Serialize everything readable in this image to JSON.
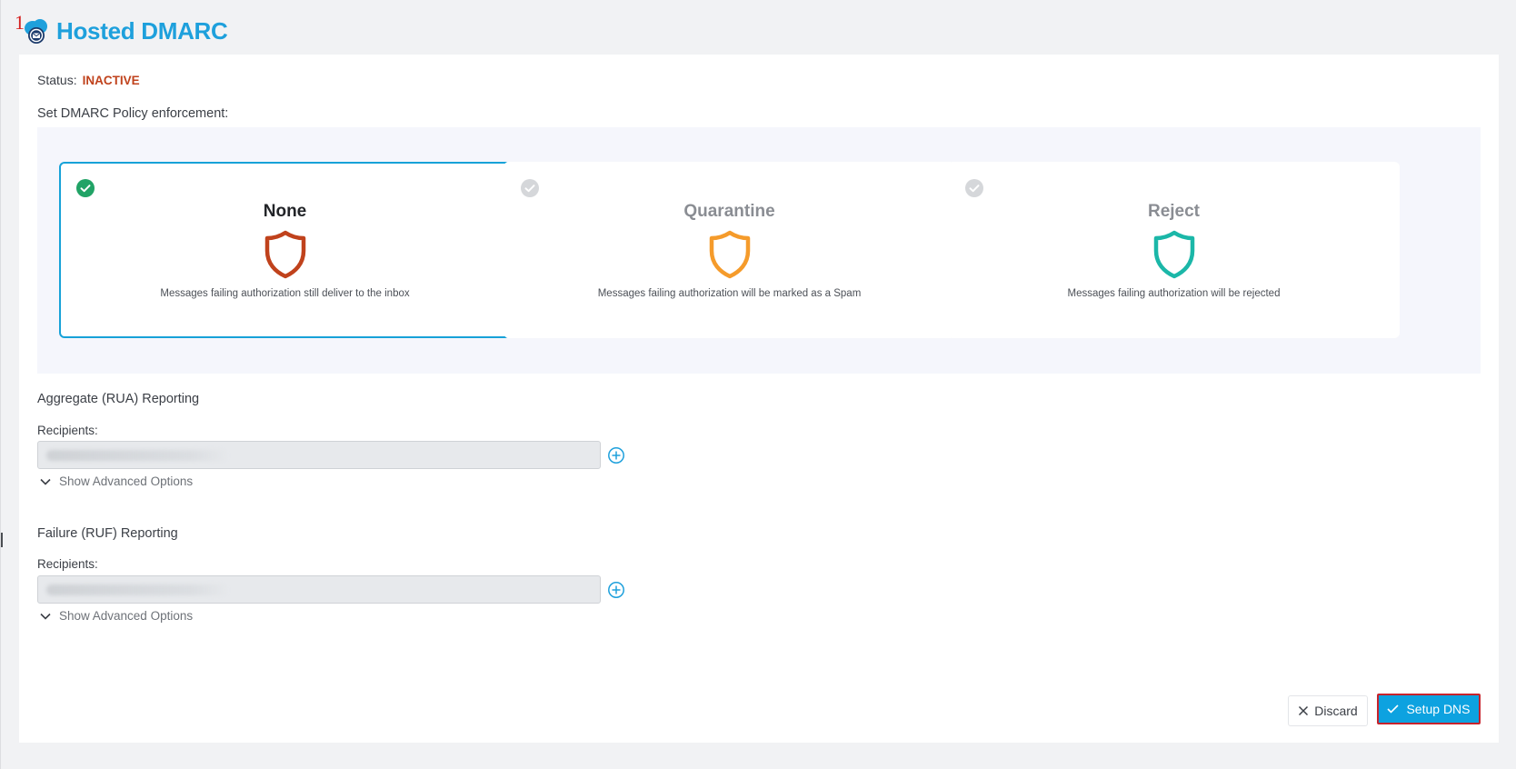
{
  "marker": "1",
  "app": {
    "title": "Hosted DMARC"
  },
  "status": {
    "label": "Status:",
    "value": "INACTIVE",
    "value_color": "#c0421c"
  },
  "policy": {
    "label": "Set DMARC Policy enforcement:",
    "selected": "None",
    "options": [
      {
        "name": "None",
        "description": "Messages failing authorization still deliver to the inbox",
        "shield_color": "#c0421c",
        "icon": "shield-icon",
        "selected": true
      },
      {
        "name": "Quarantine",
        "description": "Messages failing authorization will be marked as a Spam",
        "shield_color": "#f59b2b",
        "icon": "shield-icon",
        "selected": false
      },
      {
        "name": "Reject",
        "description": "Messages failing authorization will be rejected",
        "shield_color": "#1bb7a8",
        "icon": "shield-icon",
        "selected": false
      }
    ]
  },
  "rua": {
    "title": "Aggregate (RUA) Reporting",
    "recipients_label": "Recipients:",
    "recipients_value": "",
    "advanced_label": "Show Advanced Options"
  },
  "ruf": {
    "title": "Failure (RUF) Reporting",
    "recipients_label": "Recipients:",
    "recipients_value": "",
    "advanced_label": "Show Advanced Options"
  },
  "actions": {
    "discard_label": "Discard",
    "setup_label": "Setup DNS"
  },
  "colors": {
    "accent": "#1ea0dc",
    "selected_border": "#17a2d8",
    "check_active": "#21a366",
    "check_inactive": "#d5d7da"
  }
}
